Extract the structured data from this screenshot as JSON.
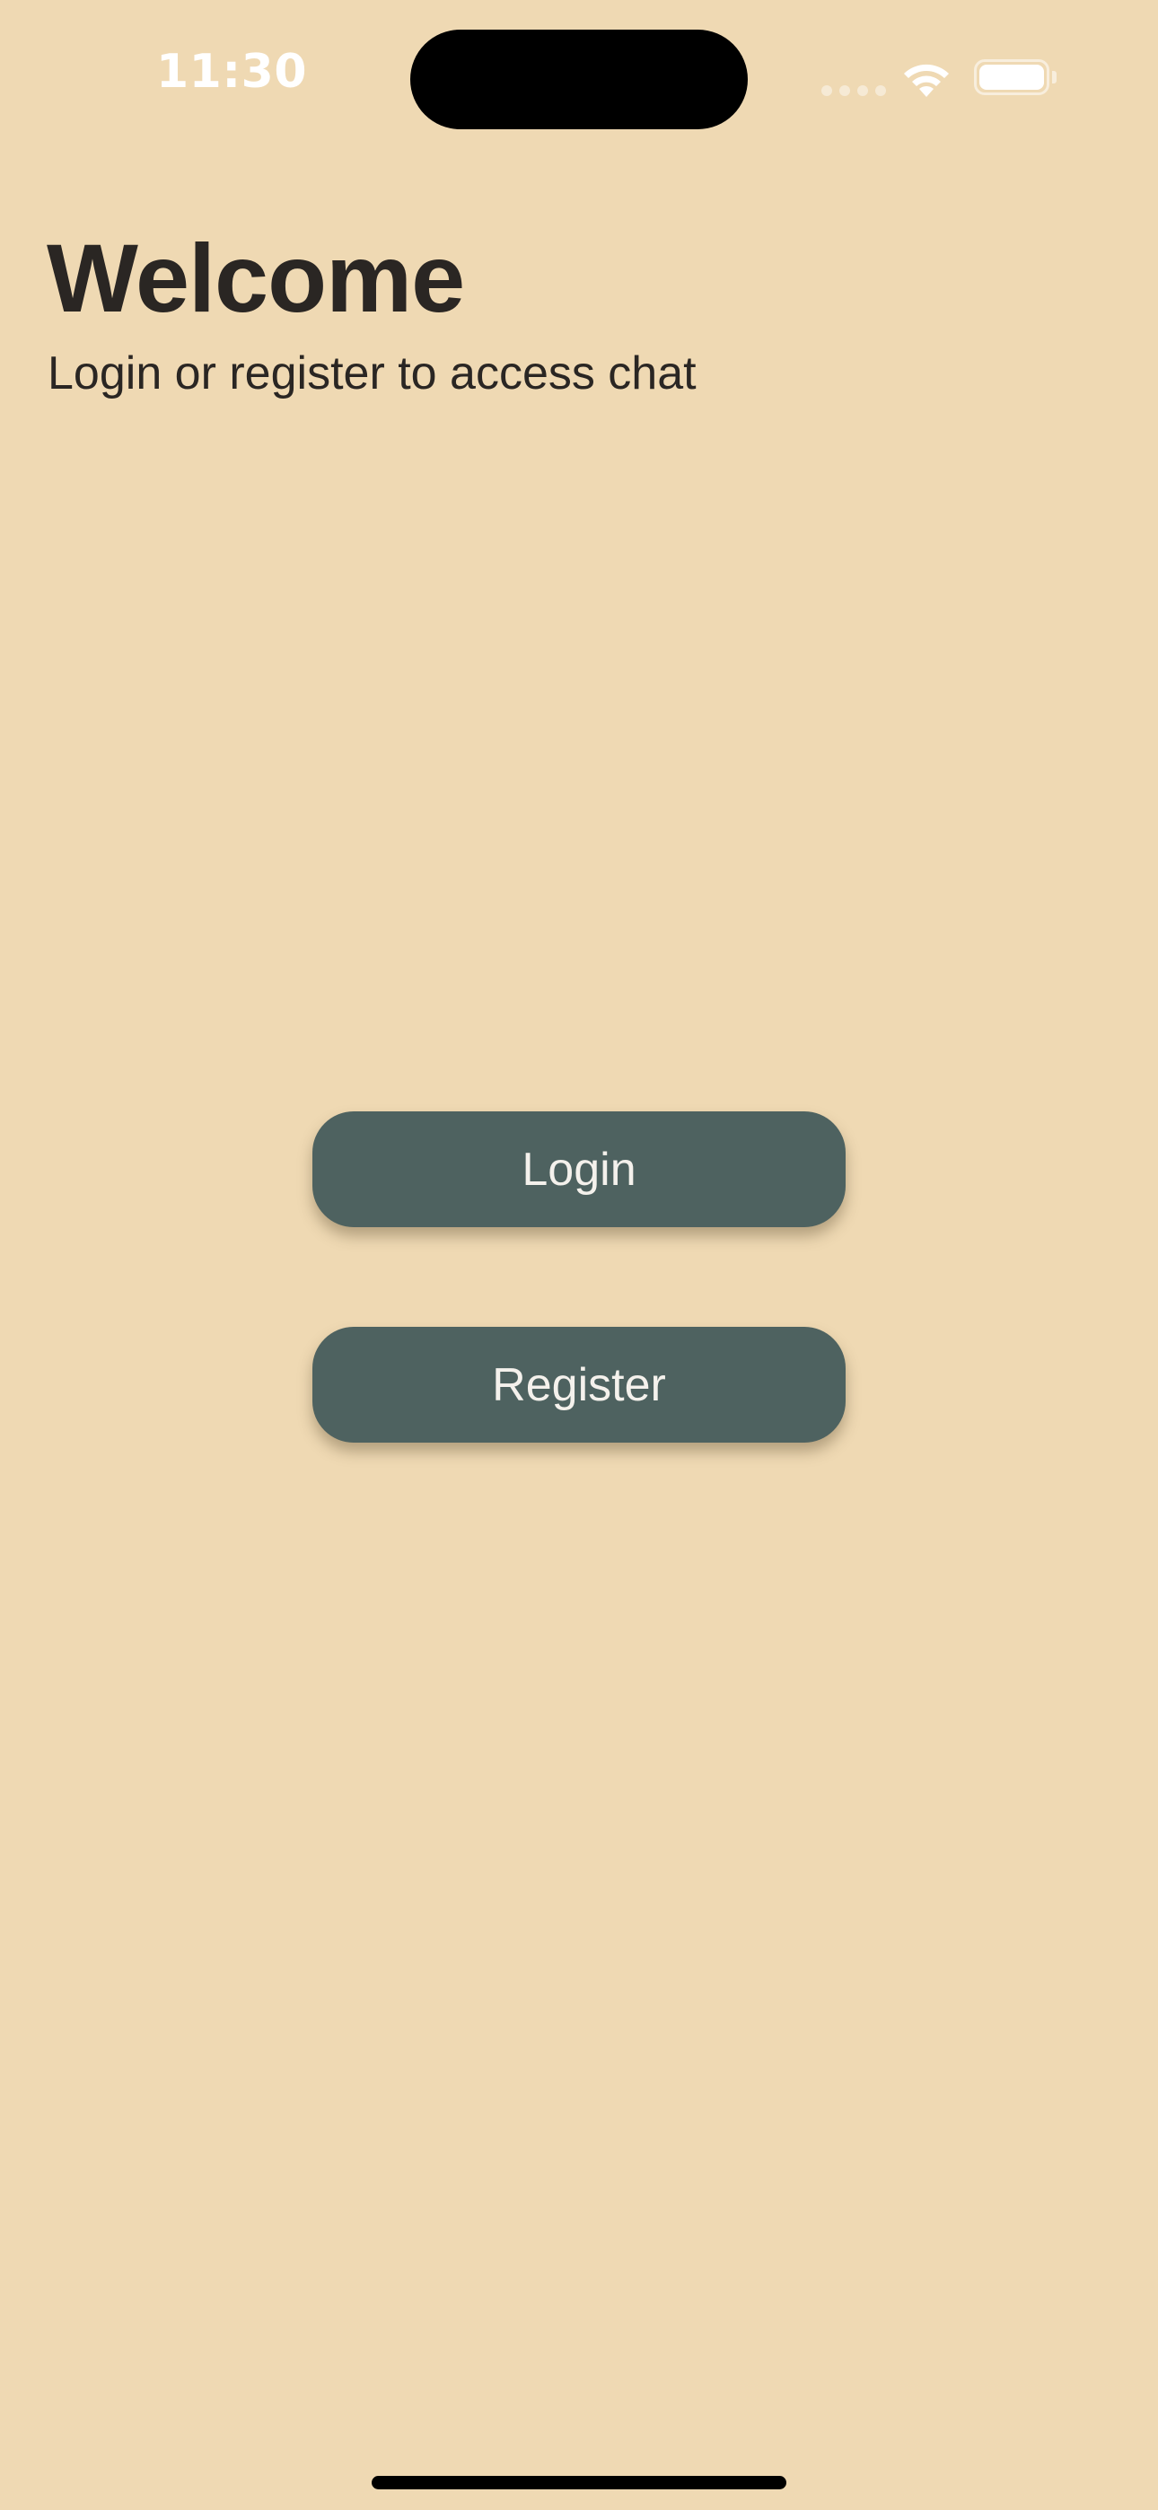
{
  "status_bar": {
    "time": "11:30",
    "signal_icon": "signal-dots-icon",
    "wifi_icon": "wifi-icon",
    "battery_icon": "battery-icon"
  },
  "header": {
    "title": "Welcome",
    "subtitle": "Login or register to access chat"
  },
  "actions": {
    "login_label": "Login",
    "register_label": "Register"
  },
  "colors": {
    "background": "#EFD9B3",
    "button": "#4E6260",
    "button_text": "#F4F1EC",
    "text": "#2A2623"
  }
}
